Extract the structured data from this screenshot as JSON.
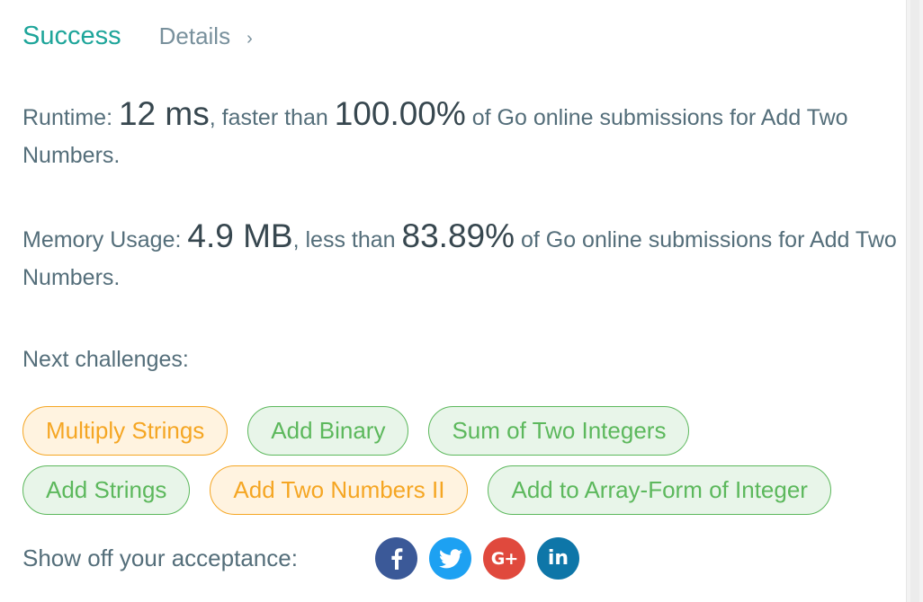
{
  "result": {
    "status": "Success",
    "details_label": "Details",
    "details_chevron": "›"
  },
  "runtime": {
    "label": "Runtime: ",
    "value": "12 ms",
    "comparison": ", faster than ",
    "percent": "100.00%",
    "suffix": " of Go online submissions for Add Two Numbers."
  },
  "memory": {
    "label": "Memory Usage: ",
    "value": "4.9 MB",
    "comparison": ", less than ",
    "percent": "83.89%",
    "suffix": " of Go online submissions for Add Two Numbers."
  },
  "next_challenges": {
    "label": "Next challenges:",
    "items": [
      {
        "title": "Multiply Strings",
        "difficulty": "medium"
      },
      {
        "title": "Add Binary",
        "difficulty": "easy"
      },
      {
        "title": "Sum of Two Integers",
        "difficulty": "easy"
      },
      {
        "title": "Add Strings",
        "difficulty": "easy"
      },
      {
        "title": "Add Two Numbers II",
        "difficulty": "medium"
      },
      {
        "title": "Add to Array-Form of Integer",
        "difficulty": "easy"
      }
    ]
  },
  "share": {
    "label": "Show off your acceptance:",
    "buttons": [
      {
        "icon": "facebook-icon",
        "glyph": "f"
      },
      {
        "icon": "twitter-icon",
        "glyph": ""
      },
      {
        "icon": "google-plus-icon",
        "glyph": "G+"
      },
      {
        "icon": "linkedin-icon",
        "glyph": "in"
      }
    ]
  },
  "colors": {
    "success": "#1ea59a",
    "medium": "#f5a623",
    "easy": "#5cb85c",
    "facebook": "#3b5998",
    "twitter": "#1da1f2",
    "google_plus": "#e0493d",
    "linkedin": "#0e76a8"
  }
}
